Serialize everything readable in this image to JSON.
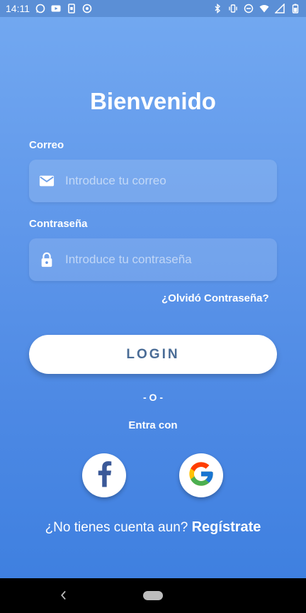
{
  "status_bar": {
    "time": "14:11",
    "left_icons": [
      "whatsapp-icon",
      "youtube-icon",
      "sim-icon",
      "sync-icon"
    ],
    "right_icons": [
      "bluetooth-icon",
      "vibrate-icon",
      "dnd-icon",
      "wifi-icon",
      "signal-icon",
      "battery-icon"
    ]
  },
  "login": {
    "title": "Bienvenido",
    "email_label": "Correo",
    "email_placeholder": "Introduce tu correo",
    "password_label": "Contraseña",
    "password_placeholder": "Introduce tu contraseña",
    "forgot": "¿Olvidó Contraseña?",
    "login_button": "LOGIN",
    "or": "- O -",
    "enter_with": "Entra con",
    "social": [
      "facebook-icon",
      "google-icon"
    ],
    "register_prompt": "¿No tienes cuenta aun?",
    "register_link": "Regístrate"
  },
  "colors": {
    "gradient_top": "#73a9f1",
    "gradient_bottom": "#3f80e0",
    "button_text": "#4a6c96",
    "facebook": "#3b5998"
  }
}
